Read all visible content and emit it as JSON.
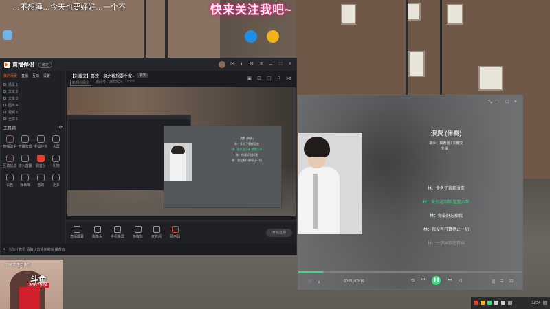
{
  "overlay": {
    "top_marquee": "…不想睡…今天也要好好…一个不",
    "big_title": "快来关注我吧~"
  },
  "app": {
    "logo": "直播伴侣",
    "badge": "绑定",
    "left_tabs": [
      "我的场景",
      "直播",
      "互动",
      "设置"
    ],
    "scenes": [
      "场景 1",
      "文本 2",
      "文本 3",
      "图片 4",
      "视频 5",
      "全屏 1"
    ],
    "tools_title": "工具箱",
    "tools": [
      {
        "label": "直播助手",
        "style": "red"
      },
      {
        "label": "直播管理",
        "style": ""
      },
      {
        "label": "主播任务",
        "style": ""
      },
      {
        "label": "大屏",
        "style": ""
      },
      {
        "label": "互动玩法",
        "style": "red"
      },
      {
        "label": "进入直播",
        "style": ""
      },
      {
        "label": "调音台",
        "style": "hot"
      },
      {
        "label": "礼物",
        "style": ""
      },
      {
        "label": "公告",
        "style": ""
      },
      {
        "label": "弹幕库",
        "style": ""
      },
      {
        "label": "音效",
        "style": ""
      },
      {
        "label": "更多",
        "style": ""
      }
    ],
    "room": {
      "title": "【刘耀文】喜欢一身之我想要个家~",
      "tag": "聊天",
      "sub_category": "新闻与娱乐",
      "room_id": "房间号：3667524",
      "followers": "1683"
    },
    "bottom_tools": [
      "直播屏幕",
      "摄像头",
      "手机投屏",
      "多媒体",
      "麦克风",
      "扬声器"
    ],
    "start_button": "开始直播",
    "status": "当前计算机 请确认直播关键帧 推荐值"
  },
  "player": {
    "title": "浪费 (伴奏)",
    "meta_line1": "歌手：林宥嘉 / 刘耀文",
    "meta_line2": "专辑：",
    "lyrics": [
      {
        "text": "林：多久了我都没变",
        "state": "normal"
      },
      {
        "text": "林：爱你这回事 整整六年",
        "state": "current"
      },
      {
        "text": "林：你最好忘掉我",
        "state": "normal"
      },
      {
        "text": "林：我没有打算停止一切",
        "state": "normal"
      },
      {
        "text": "林：一切从现在开始",
        "state": "fade"
      }
    ],
    "time": "00:21 / 03:19",
    "progress": 0.11,
    "right_labels": [
      "词",
      "10"
    ]
  },
  "cam": {
    "logo": "斗鱼",
    "number": "3667524",
    "top_text": "刘耀文 生日快乐"
  },
  "taskbar": {
    "time": "12:54"
  }
}
